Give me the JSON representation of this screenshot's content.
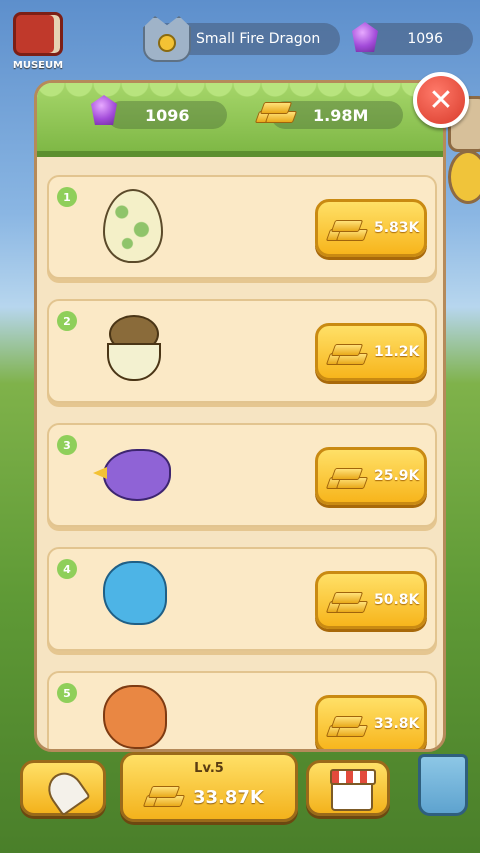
{
  "top_bar": {
    "museum_label": "MUSEUM",
    "dragon_name": "Small Fire Dragon",
    "gems": "1096"
  },
  "panel": {
    "gems": "1096",
    "gold": "1.98M"
  },
  "shop_items": [
    {
      "number": "1",
      "pet": "egg-icon",
      "price": "5.83K"
    },
    {
      "number": "2",
      "pet": "hatching-dino-icon",
      "price": "11.2K"
    },
    {
      "number": "3",
      "pet": "purple-bird-icon",
      "price": "25.9K"
    },
    {
      "number": "4",
      "pet": "blue-dino-icon",
      "price": "50.8K"
    },
    {
      "number": "5",
      "pet": "orange-dino-icon",
      "price": "33.8K"
    }
  ],
  "bottom_bar": {
    "level": "Lv.5",
    "level_cost": "33.87K"
  },
  "colors": {
    "gold_button": "#f7b51c",
    "panel_bg": "#f6e4c2",
    "header_green": "#7fb846",
    "close_red": "#d83a2a"
  }
}
